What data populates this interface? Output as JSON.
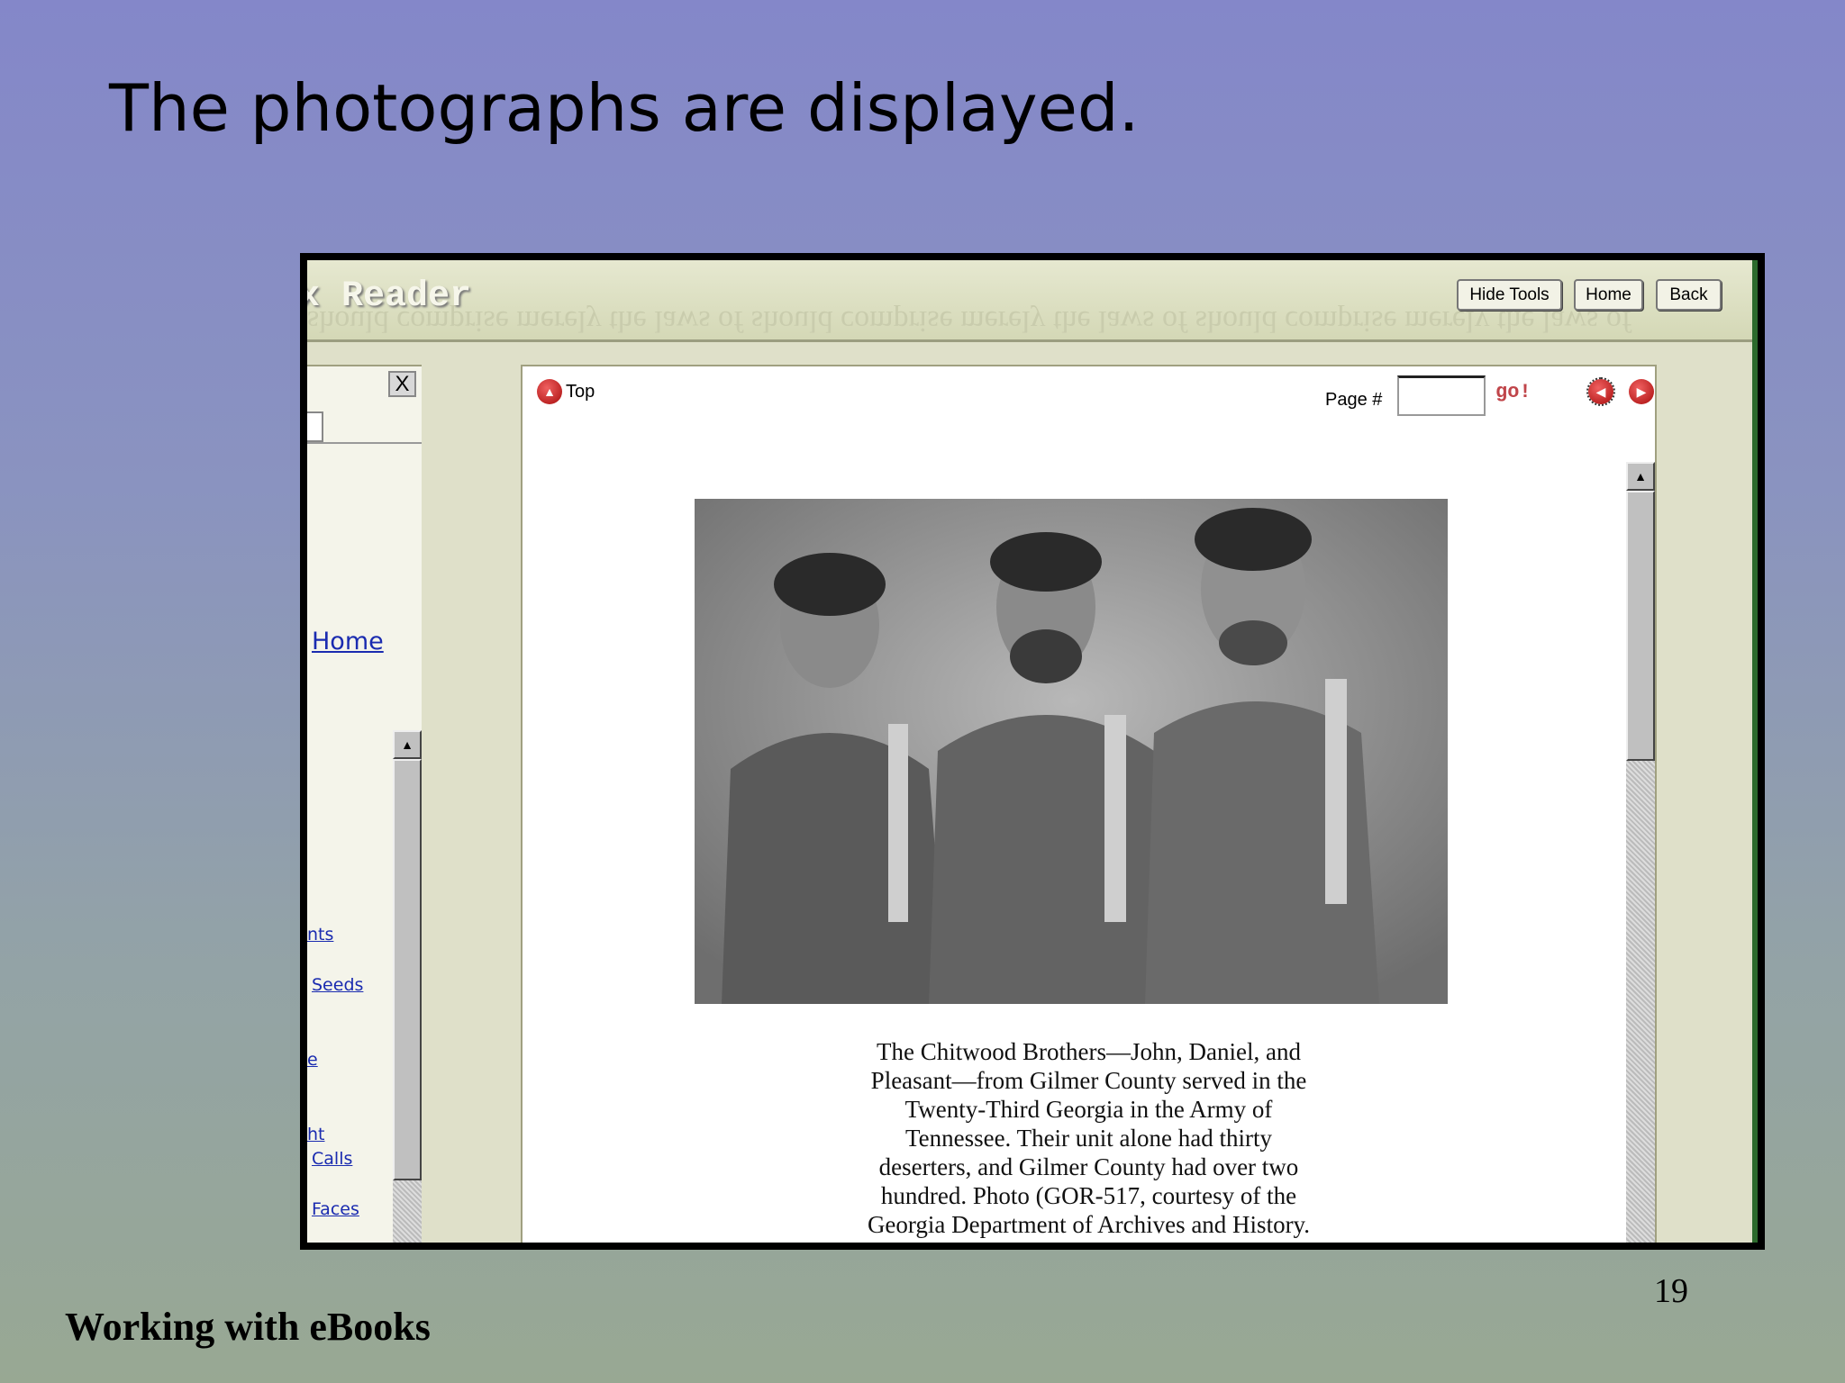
{
  "slide": {
    "title": "The photographs are displayed.",
    "page_number": "19",
    "footer": "Working with eBooks"
  },
  "app": {
    "title": "x Reader",
    "ghost_text": "should comprise merely the laws of should comprise merely the laws of should comprise merely the laws of",
    "buttons": {
      "hide_tools": "Hide Tools",
      "home": "Home",
      "back": "Back"
    }
  },
  "sidebar": {
    "close": "X",
    "links": [
      "Home",
      "nts",
      "Seeds",
      "e",
      "ht",
      "Calls",
      "Faces"
    ]
  },
  "viewer": {
    "top_label": "Top",
    "page_label": "Page #",
    "page_value": "",
    "go_label": "go!",
    "caption": [
      "The Chitwood Brothers—John, Daniel, and",
      "Pleasant—from Gilmer County served in the",
      "Twenty-Third Georgia in the Army of",
      "Tennessee. Their unit alone had thirty",
      "deserters, and Gilmer County had over two",
      "hundred. Photo (GOR-517, courtesy of the",
      "Georgia Department of Archives and History."
    ]
  }
}
